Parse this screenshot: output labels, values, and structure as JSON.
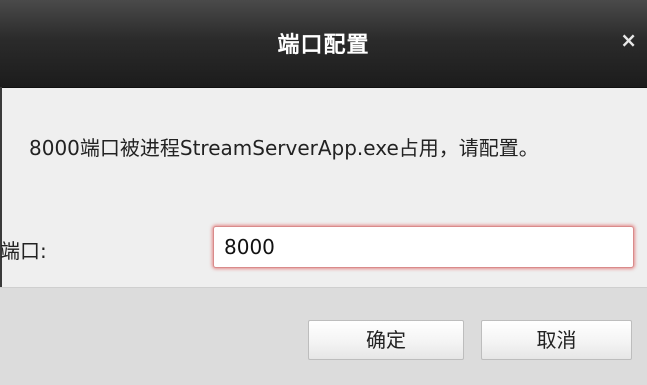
{
  "dialog": {
    "title": "端口配置",
    "close_symbol": "×",
    "message": "8000端口被进程StreamServerApp.exe占用，请配置。",
    "port_label": "端口:",
    "port_value": "8000",
    "ok_label": "确定",
    "cancel_label": "取消"
  },
  "icons": {
    "close": "close-icon"
  },
  "colors": {
    "titlebar": "#2b2b2b",
    "title_text": "#ffffff",
    "body_bg": "#efefef",
    "footer_bg": "#dcdcdc",
    "input_focus_border": "#d98b8b"
  }
}
